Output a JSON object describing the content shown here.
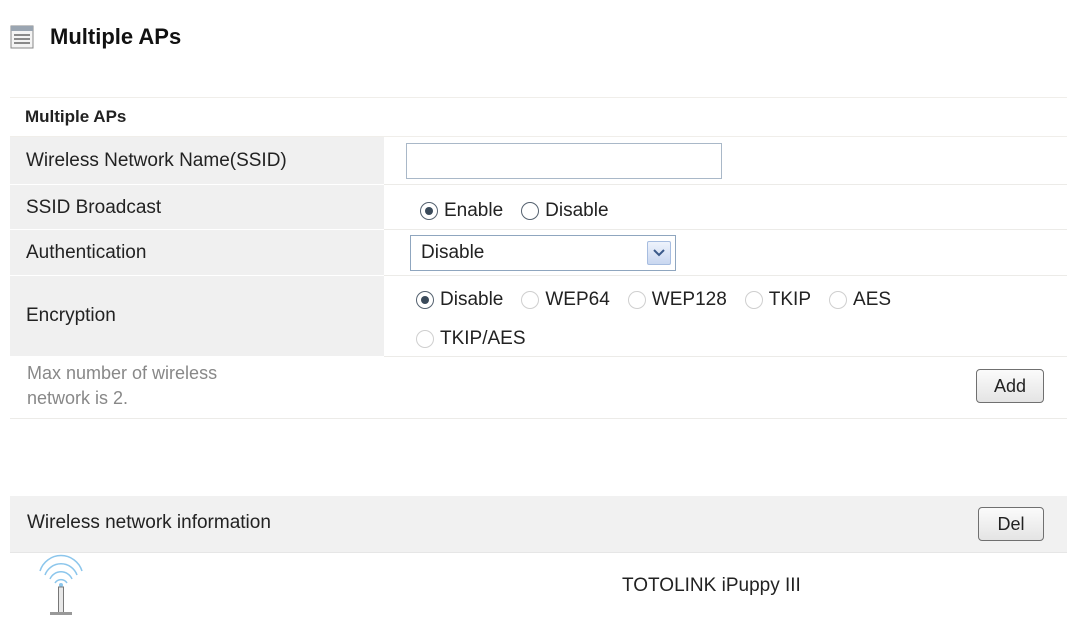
{
  "page": {
    "title": "Multiple APs"
  },
  "section": {
    "title": "Multiple APs"
  },
  "form": {
    "ssid": {
      "label": "Wireless Network Name(SSID)",
      "value": ""
    },
    "broadcast": {
      "label": "SSID Broadcast",
      "options": [
        "Enable",
        "Disable"
      ],
      "selected": "Enable"
    },
    "authentication": {
      "label": "Authentication",
      "value": "Disable"
    },
    "encryption": {
      "label": "Encryption",
      "options": [
        "Disable",
        "WEP64",
        "WEP128",
        "TKIP",
        "AES",
        "TKIP/AES"
      ],
      "selected": "Disable"
    }
  },
  "info": {
    "max_line1": "Max number of wireless",
    "max_line2": "network is 2."
  },
  "buttons": {
    "add": "Add",
    "del": "Del"
  },
  "network_info": {
    "title": "Wireless network information",
    "entries": [
      {
        "ssid": "TOTOLINK iPuppy III",
        "icon": "wifi-antenna-icon"
      }
    ]
  },
  "colors": {
    "label_bg": "#f0f0f0",
    "row_border": "#ecebe8",
    "muted_text": "#888888",
    "radio_dot": "#3a4a5a",
    "wifi_icon": "#7fbfe8"
  }
}
